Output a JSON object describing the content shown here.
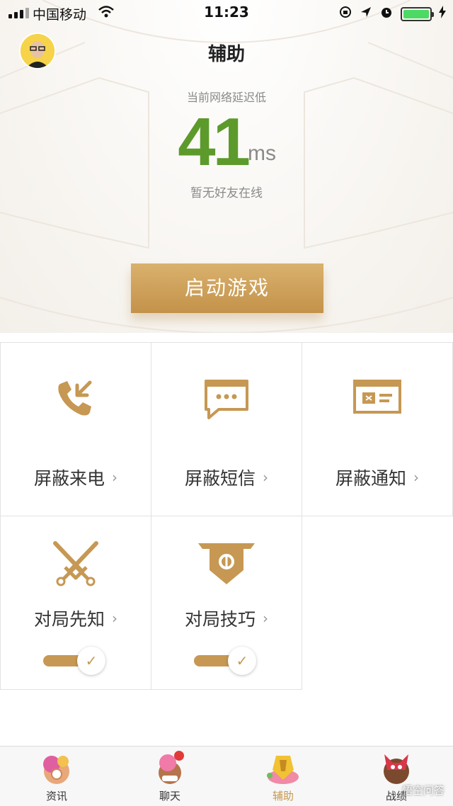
{
  "status_bar": {
    "carrier": "中国移动",
    "time": "11:23"
  },
  "header": {
    "title": "辅助",
    "latency_caption": "当前网络延迟低",
    "latency_value": "41",
    "latency_unit": "ms",
    "friends_status": "暂无好友在线",
    "start_button": "启动游戏"
  },
  "features": [
    {
      "label": "屏蔽来电",
      "icon": "phone-incoming-icon"
    },
    {
      "label": "屏蔽短信",
      "icon": "message-icon"
    },
    {
      "label": "屏蔽通知",
      "icon": "notification-card-icon"
    },
    {
      "label": "对局先知",
      "icon": "crossed-swords-icon",
      "toggle_on": true
    },
    {
      "label": "对局技巧",
      "icon": "banner-icon",
      "toggle_on": true
    }
  ],
  "tabs": [
    {
      "label": "资讯",
      "active": false
    },
    {
      "label": "聊天",
      "active": false
    },
    {
      "label": "辅助",
      "active": true
    },
    {
      "label": "战绩",
      "active": false
    }
  ],
  "watermark": "悟空问答",
  "colors": {
    "accent_gold": "#c69853",
    "latency_green": "#5d9a2c",
    "battery_green": "#4cd964"
  }
}
